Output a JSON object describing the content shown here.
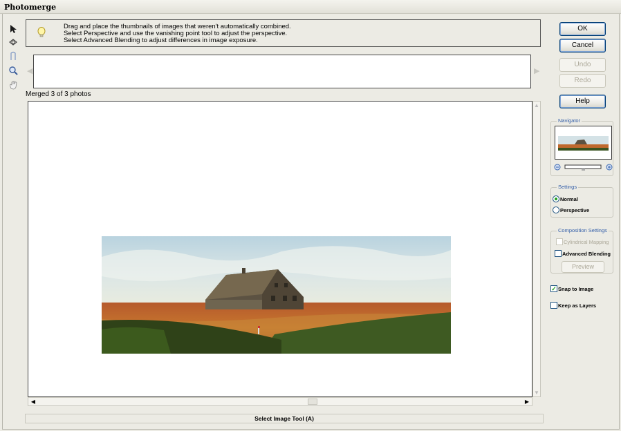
{
  "window": {
    "title": "Photomerge"
  },
  "tip": {
    "lines": [
      "Drag and place the thumbnails of images that weren't automatically combined.",
      "Select Perspective and use the vanishing point tool to adjust the perspective.",
      "Select Advanced Blending to adjust differences in image exposure."
    ]
  },
  "tools": [
    {
      "icon": "select-arrow-icon"
    },
    {
      "icon": "rotate-image-icon"
    },
    {
      "icon": "vanishing-point-icon"
    },
    {
      "icon": "zoom-icon"
    },
    {
      "icon": "hand-icon"
    }
  ],
  "canvas": {
    "merged_label": "Merged 3 of 3 photos"
  },
  "status": {
    "text": "Select Image Tool (A)"
  },
  "buttons": {
    "ok": "OK",
    "cancel": "Cancel",
    "undo": "Undo",
    "redo": "Redo",
    "help": "Help",
    "preview": "Preview"
  },
  "navigator": {
    "title": "Navigator"
  },
  "settings": {
    "title": "Settings",
    "normal": "Normal",
    "perspective": "Perspective",
    "selected": "Normal"
  },
  "composition": {
    "title": "Composition Settings",
    "cylindrical": "Cylindrical Mapping",
    "advanced_blending": "Advanced Blending",
    "cylindrical_checked": false,
    "advanced_blending_checked": false
  },
  "options": {
    "snap": "Snap to Image",
    "snap_checked": true,
    "keep_layers": "Keep as Layers",
    "keep_layers_checked": false
  },
  "colors": {
    "accent_blue": "#003c74",
    "group_title": "#335ea8",
    "check_green": "#21a121",
    "window_bg": "#ecebe4"
  }
}
